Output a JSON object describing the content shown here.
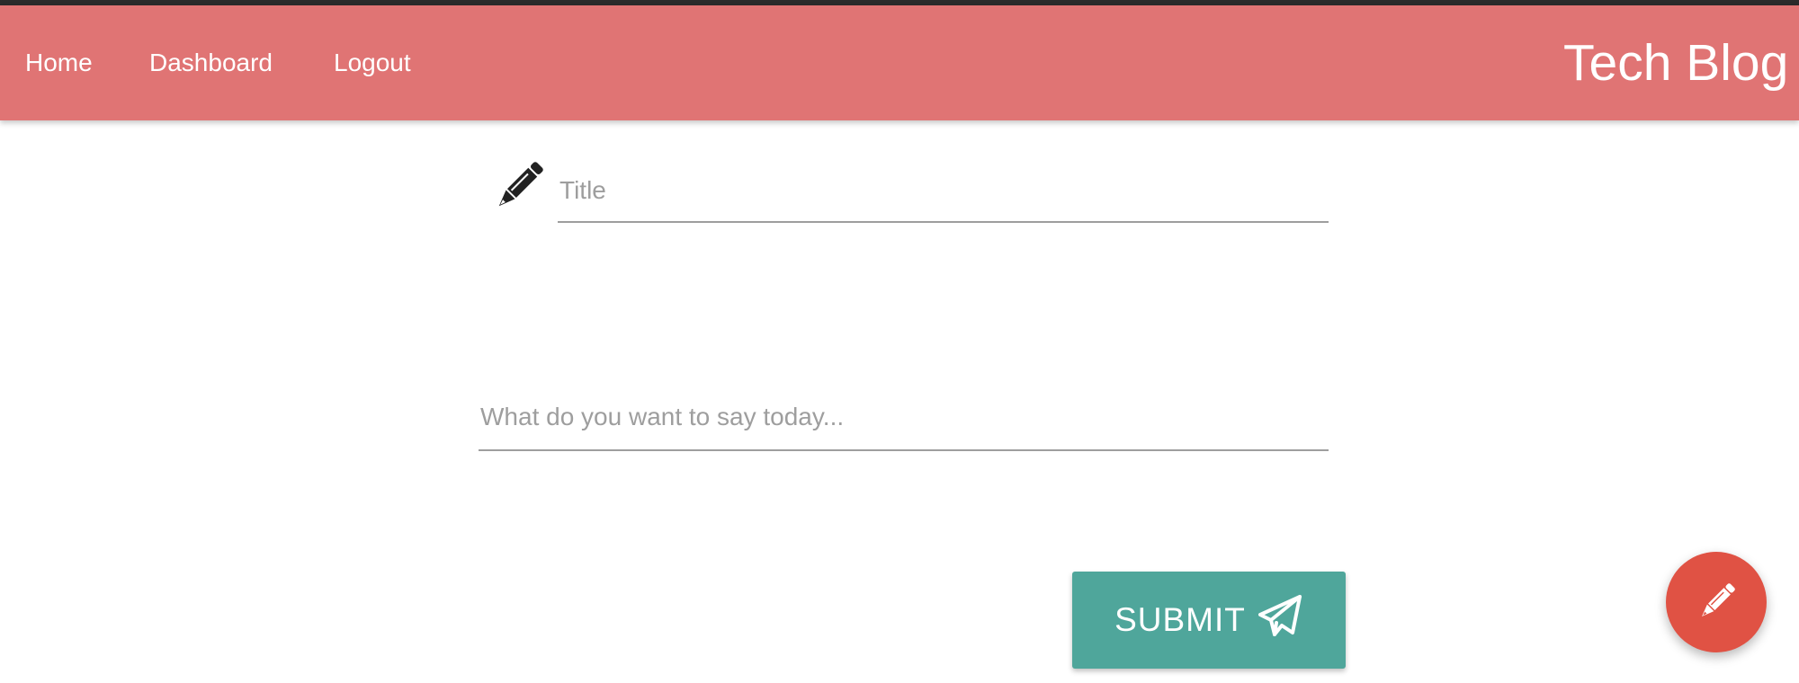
{
  "nav": {
    "links": [
      {
        "label": "Home"
      },
      {
        "label": "Dashboard"
      },
      {
        "label": "Logout"
      }
    ],
    "brand": "Tech Blog"
  },
  "form": {
    "title_placeholder": "Title",
    "title_icon": "pencil-icon",
    "body_placeholder": "What do you want to say today...",
    "submit_label": "SUBMIT",
    "submit_icon": "paper-plane-icon"
  },
  "fab": {
    "icon": "pencil-icon"
  },
  "colors": {
    "navbar": "#e07474",
    "submit": "#4fa69b",
    "fab": "#e05244",
    "icon_dark": "#222222"
  }
}
